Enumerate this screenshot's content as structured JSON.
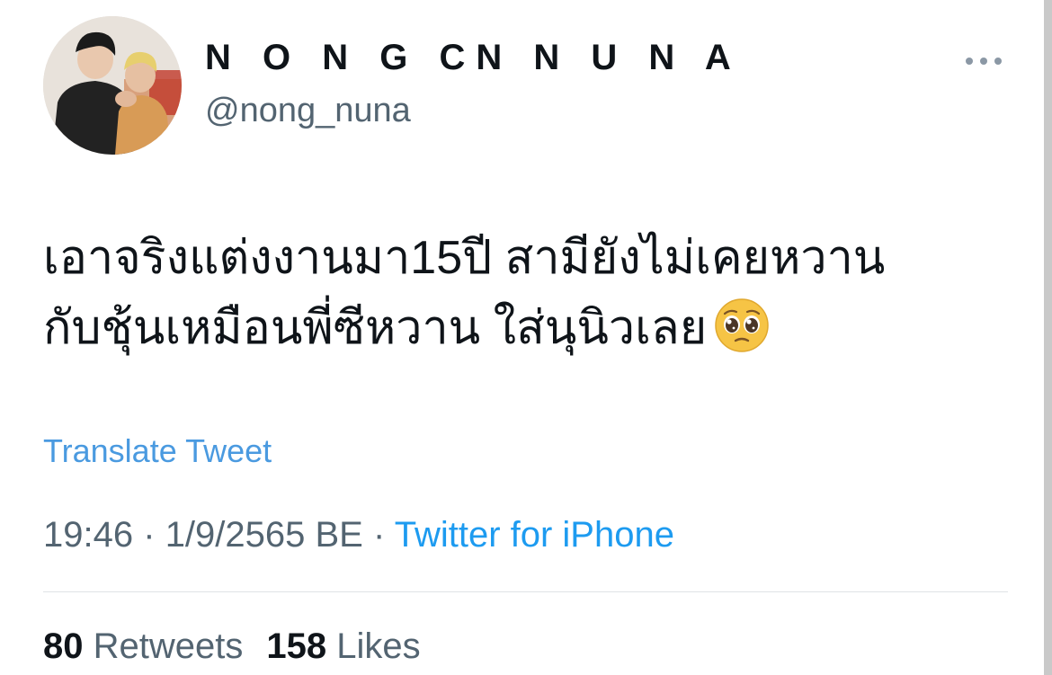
{
  "author": {
    "display_name": "N O N G CN N U N A",
    "handle": "@nong_nuna",
    "avatar_icon": "profile-photo"
  },
  "more_icon": "more-horizontal-icon",
  "tweet": {
    "line1": "เอาจริงแต่งงานมา15ปี สามียังไม่เคยหวาน",
    "line2": "กับชุ้นเหมือนพี่ซีหวาน ใส่นุนิวเลย",
    "emoji": "pleading-face-emoji"
  },
  "translate_label": "Translate Tweet",
  "meta": {
    "time": "19:46",
    "separator": "·",
    "date": "1/9/2565 BE",
    "source": "Twitter for iPhone"
  },
  "stats": {
    "retweets_count": "80",
    "retweets_label": "Retweets",
    "likes_count": "158",
    "likes_label": "Likes"
  },
  "colors": {
    "text": "#0f1419",
    "secondary": "#536471",
    "link": "#1d9bf0",
    "translate": "#4a9ae0",
    "divider": "#dfe3e6"
  }
}
